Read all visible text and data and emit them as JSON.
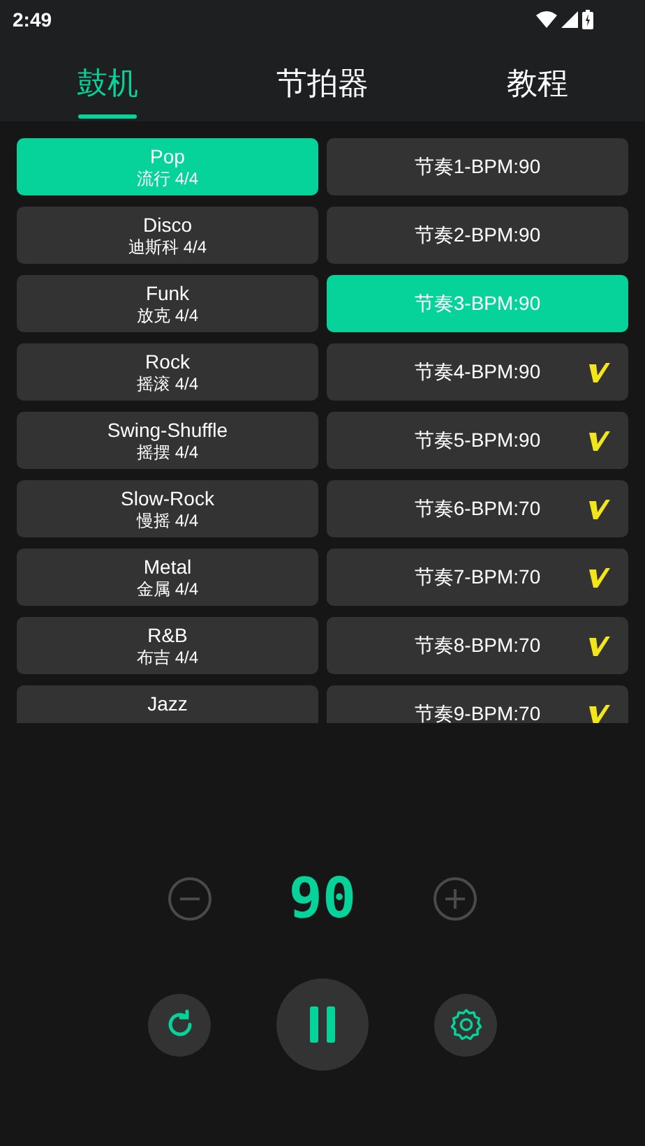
{
  "status_bar": {
    "time": "2:49"
  },
  "tabs": [
    {
      "label": "鼓机",
      "selected": true
    },
    {
      "label": "节拍器",
      "selected": false
    },
    {
      "label": "教程",
      "selected": false
    }
  ],
  "styles": [
    {
      "name": "Pop",
      "subtitle": "流行 4/4",
      "selected": true
    },
    {
      "name": "Disco",
      "subtitle": "迪斯科 4/4",
      "selected": false
    },
    {
      "name": "Funk",
      "subtitle": "放克 4/4",
      "selected": false
    },
    {
      "name": "Rock",
      "subtitle": "摇滚 4/4",
      "selected": false
    },
    {
      "name": "Swing-Shuffle",
      "subtitle": "摇摆 4/4",
      "selected": false
    },
    {
      "name": "Slow-Rock",
      "subtitle": "慢摇 4/4",
      "selected": false
    },
    {
      "name": "Metal",
      "subtitle": "金属 4/4",
      "selected": false
    },
    {
      "name": "R&B",
      "subtitle": "布吉 4/4",
      "selected": false
    },
    {
      "name": "Jazz",
      "selected": false
    }
  ],
  "rhythms": [
    {
      "label": "节奏1-BPM:90",
      "selected": false,
      "checked": false
    },
    {
      "label": "节奏2-BPM:90",
      "selected": false,
      "checked": false
    },
    {
      "label": "节奏3-BPM:90",
      "selected": true,
      "checked": false
    },
    {
      "label": "节奏4-BPM:90",
      "selected": false,
      "checked": true
    },
    {
      "label": "节奏5-BPM:90",
      "selected": false,
      "checked": true
    },
    {
      "label": "节奏6-BPM:70",
      "selected": false,
      "checked": true
    },
    {
      "label": "节奏7-BPM:70",
      "selected": false,
      "checked": true
    },
    {
      "label": "节奏8-BPM:70",
      "selected": false,
      "checked": true
    },
    {
      "label": "节奏9-BPM:70",
      "selected": false,
      "checked": true
    }
  ],
  "tempo": {
    "bpm": "90"
  },
  "player": {
    "playing": true
  }
}
